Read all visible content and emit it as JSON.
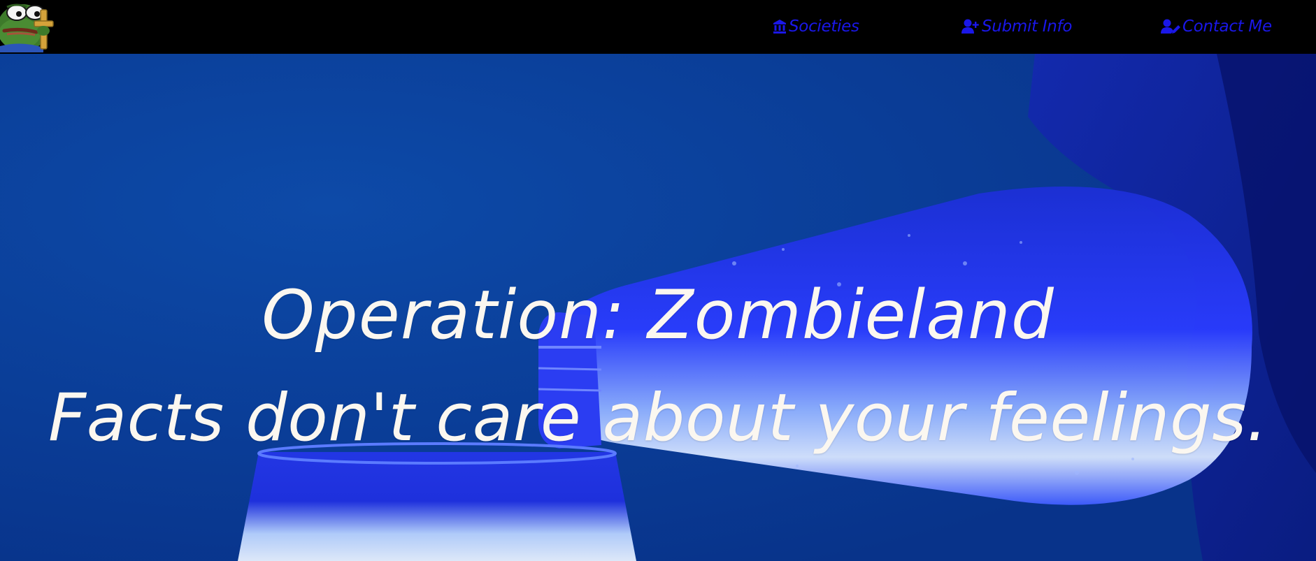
{
  "nav": {
    "logo": {
      "icon": "frog-cross-logo-icon"
    },
    "links": [
      {
        "label": "Societies",
        "icon": "bank-icon"
      },
      {
        "label": "Submit Info",
        "icon": "user-plus-icon"
      },
      {
        "label": "Contact Me",
        "icon": "user-edit-icon"
      }
    ],
    "link_color": "#1a17e8"
  },
  "hero": {
    "title": "Operation: Zombieland",
    "subtitle": "Facts don't care about your feelings.",
    "text_color": "#fbf7f0",
    "background_color": "#0b3e98"
  }
}
